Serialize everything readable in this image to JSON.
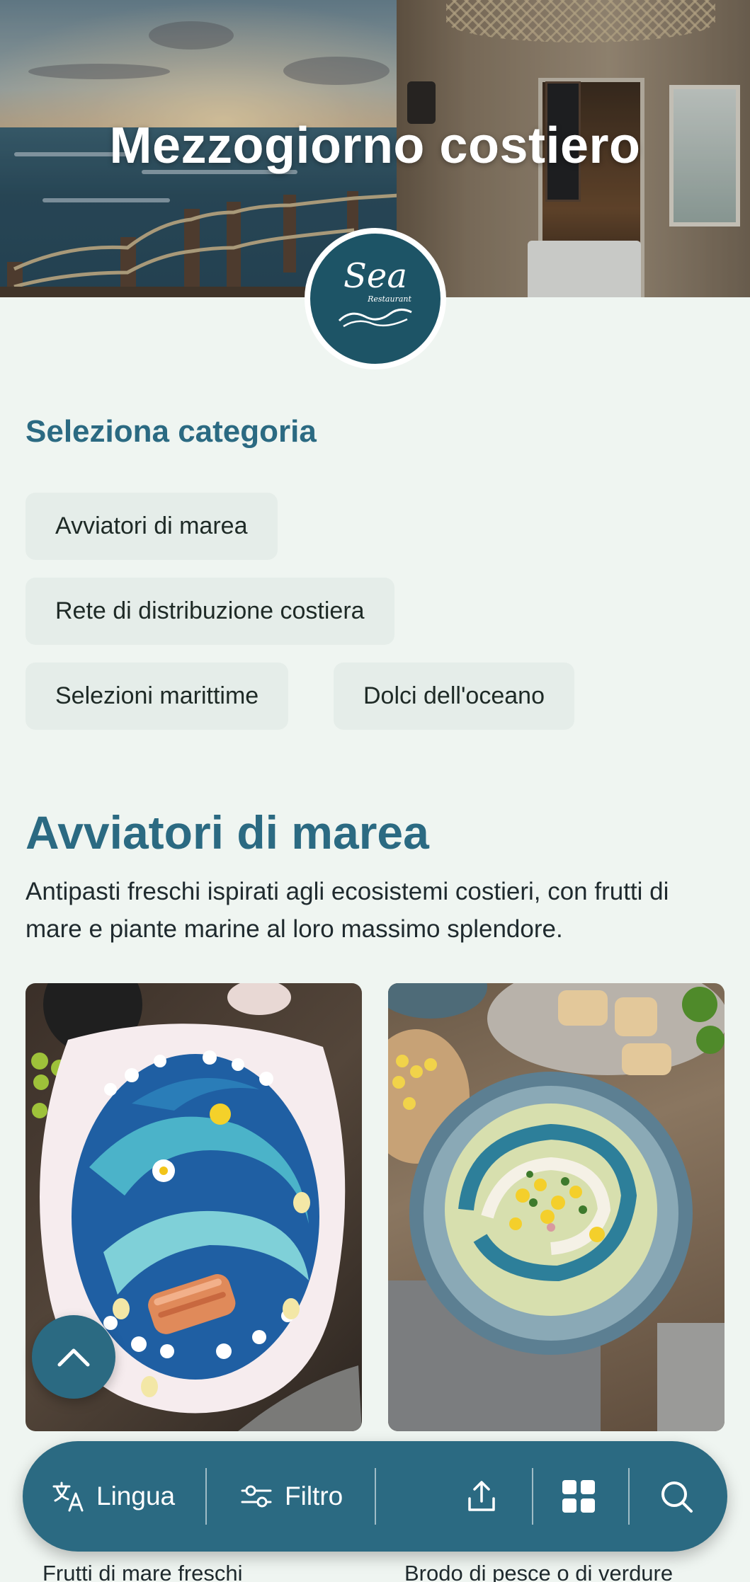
{
  "hero": {
    "title": "Mezzogiorno costiero"
  },
  "logo": {
    "word": "Sea",
    "sub": "Restaurant"
  },
  "categories": {
    "heading": "Seleziona categoria",
    "items": [
      {
        "label": "Avviatori di marea"
      },
      {
        "label": "Rete di distribuzione costiera"
      },
      {
        "label": "Selezioni marittime"
      },
      {
        "label": "Dolci dell'oceano"
      }
    ]
  },
  "section": {
    "title": "Avviatori di marea",
    "description": "Antipasti freschi ispirati agli ecosistemi costieri, con frutti di mare e piante marine al loro massimo splendore.",
    "cards": [
      {
        "label": "Frutti di mare freschi"
      },
      {
        "label": "Brodo di pesce o di verdure"
      }
    ]
  },
  "bottom_bar": {
    "language_label": "Lingua",
    "filter_label": "Filtro"
  },
  "colors": {
    "accent": "#2b6a82",
    "logo_bg": "#1d5466",
    "page_bg": "#eff5f1",
    "chip_bg": "#e5ede9"
  },
  "icons": [
    "translate-icon",
    "filter-sliders-icon",
    "share-icon",
    "grid-icon",
    "search-icon",
    "chevron-up-icon"
  ]
}
